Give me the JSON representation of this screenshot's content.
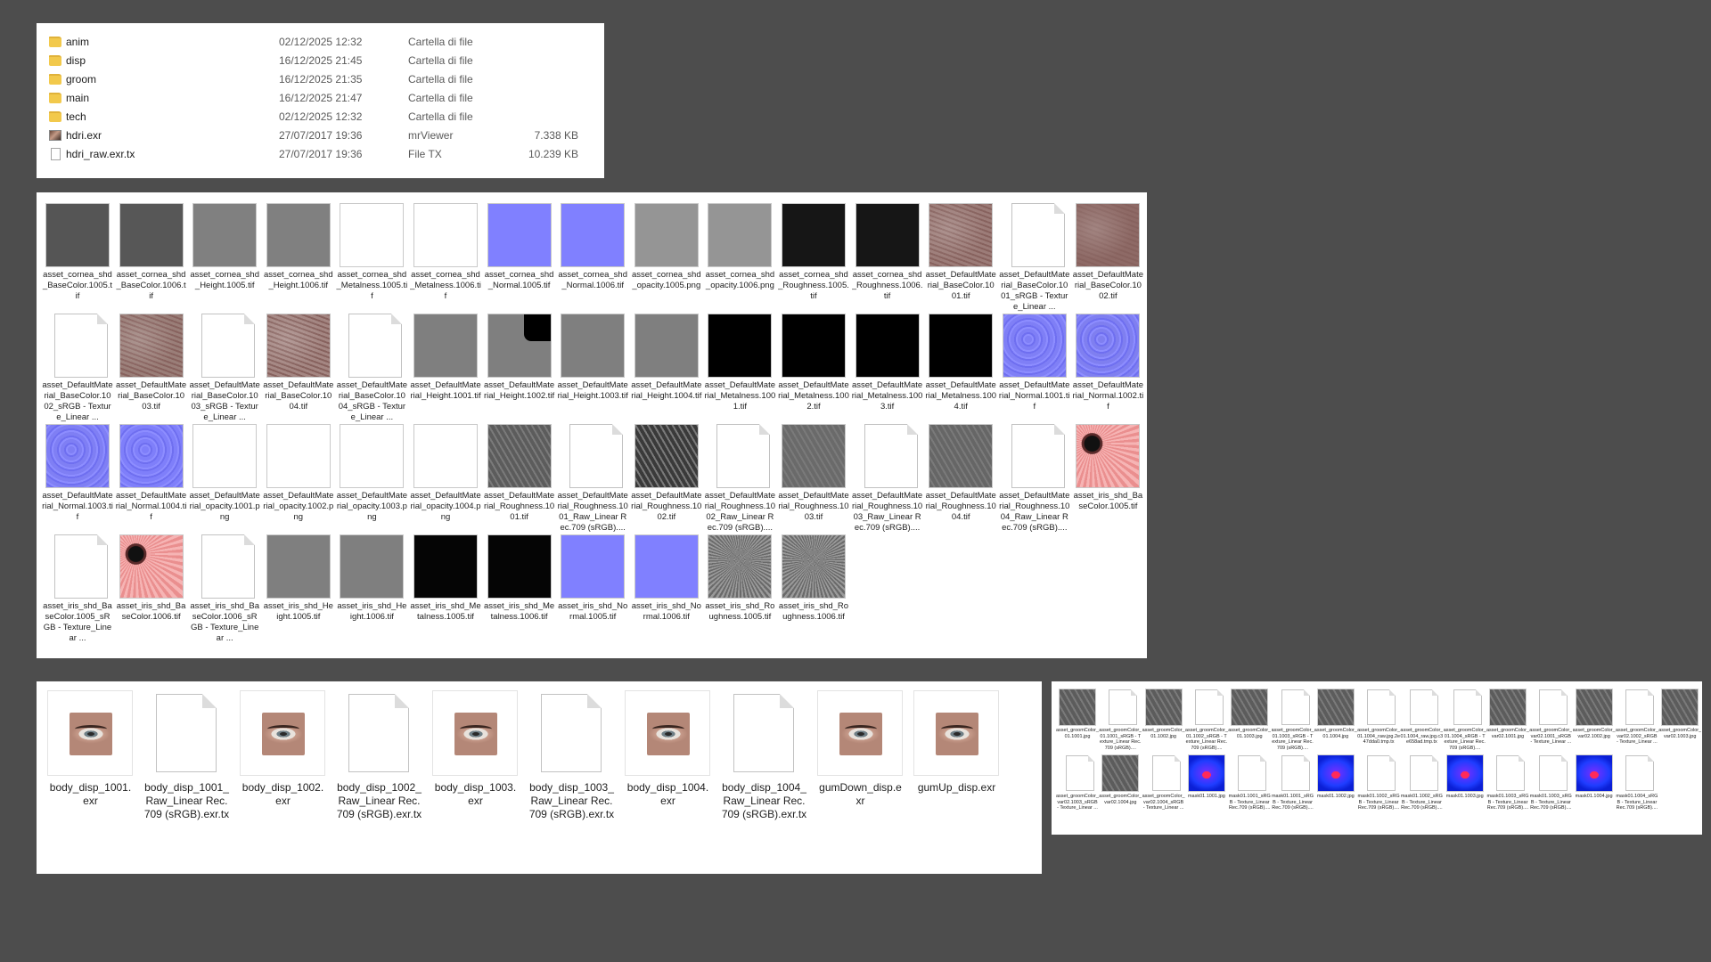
{
  "details_pane": {
    "rows": [
      {
        "icon": "folder-icon",
        "name": "anim",
        "date": "02/12/2025 12:32",
        "type": "Cartella di file",
        "size": ""
      },
      {
        "icon": "folder-icon",
        "name": "disp",
        "date": "16/12/2025 21:45",
        "type": "Cartella di file",
        "size": ""
      },
      {
        "icon": "folder-icon",
        "name": "groom",
        "date": "16/12/2025 21:35",
        "type": "Cartella di file",
        "size": ""
      },
      {
        "icon": "folder-icon",
        "name": "main",
        "date": "16/12/2025 21:47",
        "type": "Cartella di file",
        "size": ""
      },
      {
        "icon": "folder-icon",
        "name": "tech",
        "date": "02/12/2025 12:32",
        "type": "Cartella di file",
        "size": ""
      },
      {
        "icon": "image-icon",
        "name": "hdri.exr",
        "date": "27/07/2017 19:36",
        "type": "mrViewer",
        "size": "7.338 KB"
      },
      {
        "icon": "document-icon",
        "name": "hdri_raw.exr.tx",
        "date": "27/07/2017 19:36",
        "type": "File TX",
        "size": "10.239 KB"
      }
    ]
  },
  "texture_grid": {
    "items": [
      {
        "name": "asset_cornea_shd_BaseColor.1005.tif",
        "thumb": "solid",
        "color": "#555555"
      },
      {
        "name": "asset_cornea_shd_BaseColor.1006.tif",
        "thumb": "solid",
        "color": "#575757"
      },
      {
        "name": "asset_cornea_shd_Height.1005.tif",
        "thumb": "solid",
        "color": "#808080"
      },
      {
        "name": "asset_cornea_shd_Height.1006.tif",
        "thumb": "solid",
        "color": "#808080"
      },
      {
        "name": "asset_cornea_shd_Metalness.1005.tif",
        "thumb": "solid",
        "color": "#ffffff"
      },
      {
        "name": "asset_cornea_shd_Metalness.1006.tif",
        "thumb": "solid",
        "color": "#ffffff"
      },
      {
        "name": "asset_cornea_shd_Normal.1005.tif",
        "thumb": "solid",
        "color": "#8080ff"
      },
      {
        "name": "asset_cornea_shd_Normal.1006.tif",
        "thumb": "solid",
        "color": "#8080ff"
      },
      {
        "name": "asset_cornea_shd_opacity.1005.png",
        "thumb": "solid",
        "color": "#959595"
      },
      {
        "name": "asset_cornea_shd_opacity.1006.png",
        "thumb": "solid",
        "color": "#959595"
      },
      {
        "name": "asset_cornea_shd_Roughness.1005.tif",
        "thumb": "solid",
        "color": "#161616"
      },
      {
        "name": "asset_cornea_shd_Roughness.1006.tif",
        "thumb": "solid",
        "color": "#161616"
      },
      {
        "name": "asset_DefaultMaterial_BaseColor.1001.tif",
        "thumb": "skin",
        "color": "#9c7c78"
      },
      {
        "name": "asset_DefaultMaterial_BaseColor.1001_sRGB - Texture_Linear ...",
        "thumb": "doc",
        "color": ""
      },
      {
        "name": "asset_DefaultMaterial_BaseColor.1002.tif",
        "thumb": "skin",
        "color": "#8e6a66"
      },
      {
        "name": "asset_DefaultMaterial_BaseColor.1002_sRGB - Texture_Linear ...",
        "thumb": "doc",
        "color": ""
      },
      {
        "name": "asset_DefaultMaterial_BaseColor.1003.tif",
        "thumb": "skin",
        "color": "#9a7e78"
      },
      {
        "name": "asset_DefaultMaterial_BaseColor.1003_sRGB - Texture_Linear ...",
        "thumb": "doc",
        "color": ""
      },
      {
        "name": "asset_DefaultMaterial_BaseColor.1004.tif",
        "thumb": "skin",
        "color": "#a48682"
      },
      {
        "name": "asset_DefaultMaterial_BaseColor.1004_sRGB - Texture_Linear ...",
        "thumb": "doc",
        "color": ""
      },
      {
        "name": "asset_DefaultMaterial_Height.1001.tif",
        "thumb": "solid",
        "color": "#7f7f7f"
      },
      {
        "name": "asset_DefaultMaterial_Height.1002.tif",
        "thumb": "split",
        "color": "#7f7f7f"
      },
      {
        "name": "asset_DefaultMaterial_Height.1003.tif",
        "thumb": "solid",
        "color": "#7f7f7f"
      },
      {
        "name": "asset_DefaultMaterial_Height.1004.tif",
        "thumb": "solid",
        "color": "#7f7f7f"
      },
      {
        "name": "asset_DefaultMaterial_Metalness.1001.tif",
        "thumb": "solid",
        "color": "#000000"
      },
      {
        "name": "asset_DefaultMaterial_Metalness.1002.tif",
        "thumb": "solid",
        "color": "#000000"
      },
      {
        "name": "asset_DefaultMaterial_Metalness.1003.tif",
        "thumb": "solid",
        "color": "#000000"
      },
      {
        "name": "asset_DefaultMaterial_Metalness.1004.tif",
        "thumb": "solid",
        "color": "#000000"
      },
      {
        "name": "asset_DefaultMaterial_Normal.1001.tif",
        "thumb": "normal",
        "color": "#7f7ff6"
      },
      {
        "name": "asset_DefaultMaterial_Normal.1002.tif",
        "thumb": "normal",
        "color": "#7f7ff0"
      },
      {
        "name": "asset_DefaultMaterial_Normal.1003.tif",
        "thumb": "normal",
        "color": "#7f7ff4"
      },
      {
        "name": "asset_DefaultMaterial_Normal.1004.tif",
        "thumb": "normal",
        "color": "#7f7ffa"
      },
      {
        "name": "asset_DefaultMaterial_opacity.1001.png",
        "thumb": "solid",
        "color": "#ffffff"
      },
      {
        "name": "asset_DefaultMaterial_opacity.1002.png",
        "thumb": "solid",
        "color": "#ffffff"
      },
      {
        "name": "asset_DefaultMaterial_opacity.1003.png",
        "thumb": "solid",
        "color": "#ffffff"
      },
      {
        "name": "asset_DefaultMaterial_opacity.1004.png",
        "thumb": "solid",
        "color": "#ffffff"
      },
      {
        "name": "asset_DefaultMaterial_Roughness.1001.tif",
        "thumb": "rough",
        "color": "#5c5c5c"
      },
      {
        "name": "asset_DefaultMaterial_Roughness.1001_Raw_Linear Rec.709 (sRGB)....",
        "thumb": "doc",
        "color": ""
      },
      {
        "name": "asset_DefaultMaterial_Roughness.1002.tif",
        "thumb": "rough",
        "color": "#3a3a3a"
      },
      {
        "name": "asset_DefaultMaterial_Roughness.1002_Raw_Linear Rec.709 (sRGB)....",
        "thumb": "doc",
        "color": ""
      },
      {
        "name": "asset_DefaultMaterial_Roughness.1003.tif",
        "thumb": "rough",
        "color": "#6a6a6a"
      },
      {
        "name": "asset_DefaultMaterial_Roughness.1003_Raw_Linear Rec.709 (sRGB)....",
        "thumb": "doc",
        "color": ""
      },
      {
        "name": "asset_DefaultMaterial_Roughness.1004.tif",
        "thumb": "rough",
        "color": "#666666"
      },
      {
        "name": "asset_DefaultMaterial_Roughness.1004_Raw_Linear Rec.709 (sRGB)....",
        "thumb": "doc",
        "color": ""
      },
      {
        "name": "asset_iris_shd_BaseColor.1005.tif",
        "thumb": "iris",
        "color": "#f0a0a0"
      },
      {
        "name": "asset_iris_shd_BaseColor.1005_sRGB - Texture_Linear ...",
        "thumb": "doc",
        "color": ""
      },
      {
        "name": "asset_iris_shd_BaseColor.1006.tif",
        "thumb": "iris",
        "color": "#f0a0a0"
      },
      {
        "name": "asset_iris_shd_BaseColor.1006_sRGB - Texture_Linear ...",
        "thumb": "doc",
        "color": ""
      },
      {
        "name": "asset_iris_shd_Height.1005.tif",
        "thumb": "solid",
        "color": "#7f7f7f"
      },
      {
        "name": "asset_iris_shd_Height.1006.tif",
        "thumb": "solid",
        "color": "#7f7f7f"
      },
      {
        "name": "asset_iris_shd_Metalness.1005.tif",
        "thumb": "solid",
        "color": "#050505"
      },
      {
        "name": "asset_iris_shd_Metalness.1006.tif",
        "thumb": "solid",
        "color": "#050505"
      },
      {
        "name": "asset_iris_shd_Normal.1005.tif",
        "thumb": "solid",
        "color": "#8080ff"
      },
      {
        "name": "asset_iris_shd_Normal.1006.tif",
        "thumb": "solid",
        "color": "#8080ff"
      },
      {
        "name": "asset_iris_shd_Roughness.1005.tif",
        "thumb": "radial",
        "color": "#808080"
      },
      {
        "name": "asset_iris_shd_Roughness.1006.tif",
        "thumb": "radial",
        "color": "#808080"
      }
    ]
  },
  "disp_grid": {
    "items": [
      {
        "name": "body_disp_1001.exr",
        "thumb": "eye"
      },
      {
        "name": "body_disp_1001_Raw_Linear Rec.709 (sRGB).exr.tx",
        "thumb": "doc"
      },
      {
        "name": "body_disp_1002.exr",
        "thumb": "eye"
      },
      {
        "name": "body_disp_1002_Raw_Linear Rec.709 (sRGB).exr.tx",
        "thumb": "doc"
      },
      {
        "name": "body_disp_1003.exr",
        "thumb": "eye"
      },
      {
        "name": "body_disp_1003_Raw_Linear Rec.709 (sRGB).exr.tx",
        "thumb": "doc"
      },
      {
        "name": "body_disp_1004.exr",
        "thumb": "eye"
      },
      {
        "name": "body_disp_1004_Raw_Linear Rec.709 (sRGB).exr.tx",
        "thumb": "doc"
      },
      {
        "name": "gumDown_disp.exr",
        "thumb": "eye"
      },
      {
        "name": "gumUp_disp.exr",
        "thumb": "eye"
      }
    ]
  },
  "groom_grid": {
    "items": [
      {
        "name": "asset_groomColor_01.1001.jpg",
        "thumb": "rough"
      },
      {
        "name": "asset_groomColor_01.1001_sRGB - Texture_Linear Rec.709 (sRGB)....",
        "thumb": "doc"
      },
      {
        "name": "asset_groomColor_01.1002.jpg",
        "thumb": "rough"
      },
      {
        "name": "asset_groomColor_01.1002_sRGB - Texture_Linear Rec.709 (sRGB)....",
        "thumb": "doc"
      },
      {
        "name": "asset_groomColor_01.1003.jpg",
        "thumb": "rough"
      },
      {
        "name": "asset_groomColor_01.1003_sRGB - Texture_Linear Rec.709 (sRGB)....",
        "thumb": "doc"
      },
      {
        "name": "asset_groomColor_01.1004.jpg",
        "thumb": "rough"
      },
      {
        "name": "asset_groomColor_01.1004_raw.jpg.2e47dda0.tmp.tx",
        "thumb": "doc"
      },
      {
        "name": "asset_groomColor_01.1004_raw.jpg.c3e658ad.tmp.tx",
        "thumb": "doc"
      },
      {
        "name": "asset_groomColor_01.1004_sRGB - Texture_Linear Rec.709 (sRGB)....",
        "thumb": "doc"
      },
      {
        "name": "asset_groomColor_var02.1001.jpg",
        "thumb": "rough"
      },
      {
        "name": "asset_groomColor_var02.1001_sRGB - Texture_Linear ...",
        "thumb": "doc"
      },
      {
        "name": "asset_groomColor_var02.1002.jpg",
        "thumb": "rough"
      },
      {
        "name": "asset_groomColor_var02.1002_sRGB - Texture_Linear ...",
        "thumb": "doc"
      },
      {
        "name": "asset_groomColor_var02.1003.jpg",
        "thumb": "rough"
      },
      {
        "name": "asset_groomColor_var02.1003_sRGB - Texture_Linear ...",
        "thumb": "doc"
      },
      {
        "name": "asset_groomColor_var02.1004.jpg",
        "thumb": "rough"
      },
      {
        "name": "asset_groomColor_var02.1004_sRGB - Texture_Linear ...",
        "thumb": "doc"
      },
      {
        "name": "mask01.1001.jpg",
        "thumb": "mask"
      },
      {
        "name": "mask01.1001_sRGB - Texture_Linear Rec.709 (sRGB)....",
        "thumb": "doc"
      },
      {
        "name": "mask01.1001_sRGB - Texture_Linear Rec.709 (sRGB)....",
        "thumb": "doc"
      },
      {
        "name": "mask01.1002.jpg",
        "thumb": "mask"
      },
      {
        "name": "mask01.1002_sRGB - Texture_Linear Rec.709 (sRGB)....",
        "thumb": "doc"
      },
      {
        "name": "mask01.1002_sRGB - Texture_Linear Rec.709 (sRGB)....",
        "thumb": "doc"
      },
      {
        "name": "mask01.1003.jpg",
        "thumb": "mask"
      },
      {
        "name": "mask01.1003_sRGB - Texture_Linear Rec.709 (sRGB)....",
        "thumb": "doc"
      },
      {
        "name": "mask01.1003_sRGB - Texture_Linear Rec.709 (sRGB)....",
        "thumb": "doc"
      },
      {
        "name": "mask01.1004.jpg",
        "thumb": "mask"
      },
      {
        "name": "mask01.1004_sRGB - Texture_Linear Rec.709 (sRGB)....",
        "thumb": "doc"
      }
    ]
  }
}
